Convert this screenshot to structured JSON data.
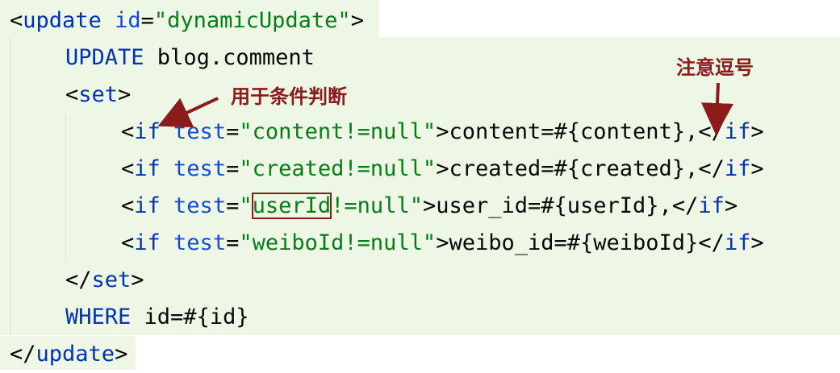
{
  "code": {
    "line0": {
      "open": "<",
      "tag": "update",
      "sp": " ",
      "attr": "id",
      "eq": "=",
      "val": "\"dynamicUpdate\"",
      "close": ">"
    },
    "line1": {
      "kw": "UPDATE",
      "rest": " blog.comment"
    },
    "line2": {
      "open": "<",
      "tag": "set",
      "close": ">"
    },
    "line3": {
      "open": "<",
      "tag": "if",
      "sp": " ",
      "attr": "test",
      "eq": "=",
      "val": "\"content!=null\"",
      "close": ">",
      "body": "content=#{content},",
      "endopen": "</",
      "endtag": "if",
      "endclose": ">"
    },
    "line4": {
      "open": "<",
      "tag": "if",
      "sp": " ",
      "attr": "test",
      "eq": "=",
      "val": "\"created!=null\"",
      "close": ">",
      "body": "created=#{created},",
      "endopen": "</",
      "endtag": "if",
      "endclose": ">"
    },
    "line5": {
      "open": "<",
      "tag": "if",
      "sp": " ",
      "attr": "test",
      "eq": "=",
      "val_q1": "\"",
      "val_boxed": "userId",
      "val_rest": "!=null\"",
      "close": ">",
      "body": "user_id=#{userId},",
      "endopen": "</",
      "endtag": "if",
      "endclose": ">"
    },
    "line6": {
      "open": "<",
      "tag": "if",
      "sp": " ",
      "attr": "test",
      "eq": "=",
      "val": "\"weiboId!=null\"",
      "close": ">",
      "body": "weibo_id=#{weiboId}",
      "endopen": "</",
      "endtag": "if",
      "endclose": ">"
    },
    "line7": {
      "open": "</",
      "tag": "set",
      "close": ">"
    },
    "line8": {
      "kw": "WHERE",
      "rest": " id=#{id}"
    },
    "line9": {
      "open": "</",
      "tag": "update",
      "close": ">"
    }
  },
  "annotations": {
    "condition_note": "用于条件判断",
    "comma_note": "注意逗号"
  },
  "colors": {
    "annotation": "#8b1a1a",
    "tag_keyword": "#0033b3",
    "string": "#067d17",
    "highlight_band": "#eef7e6"
  }
}
